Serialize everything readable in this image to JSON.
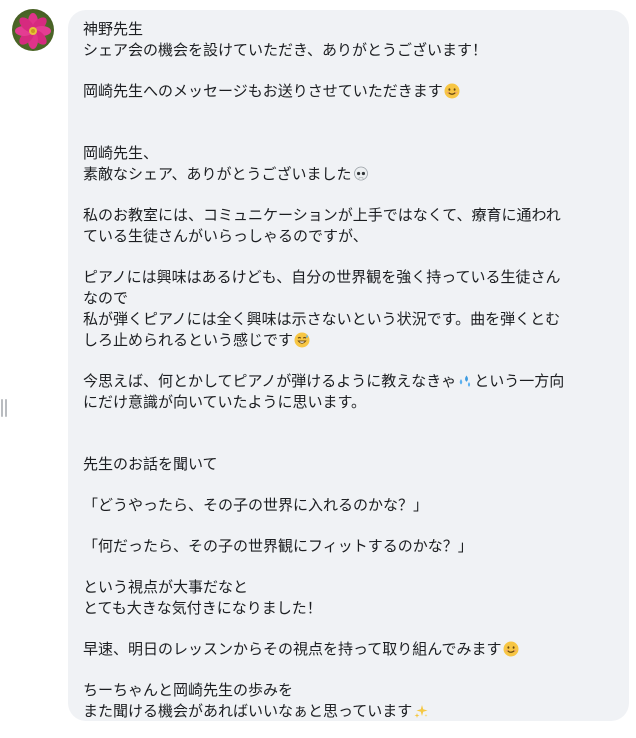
{
  "message": {
    "sender": "神野先生",
    "lines": {
      "l1": "シェア会の機会を設けていただき、ありがとうございます！",
      "l2": "岡崎先生へのメッセージもお送りさせていただきます",
      "l3": "岡崎先生、",
      "l4": "素敵なシェア、ありがとうございました",
      "l5": "私のお教室には、コミュニケーションが上手ではなくて、療育に通われ",
      "l6": "ている生徒さんがいらっしゃるのですが、",
      "l7": "ピアノには興味はあるけども、自分の世界観を強く持っている生徒さん",
      "l8": "なので",
      "l9": "私が弾くピアノには全く興味は示さないという状況です。曲を弾くとむ",
      "l10": "しろ止められるという感じです",
      "l11": "今思えば、何とかしてピアノが弾けるように教えなきゃ",
      "l11b": "という一方向",
      "l12": "にだけ意識が向いていたように思います。",
      "l13": "先生のお話を聞いて",
      "l14": "「どうやったら、その子の世界に入れるのかな？」",
      "l15": "「何だったら、その子の世界観にフィットするのかな？」",
      "l16": "という視点が大事だなと",
      "l17": "とても大きな気付きになりました！",
      "l18": "早速、明日のレッスンからその視点を持って取り組んでみます",
      "l19": "ちーちゃんと岡崎先生の歩みを",
      "l20": "また聞ける機会があればいいなぁと思っています"
    }
  },
  "icons": {
    "avatar": "cosmos-flower-avatar",
    "smile": "smiling-face-emoji",
    "skull": "skull-emoji",
    "sweat": "grinning-sweat-emoji",
    "droplets": "sweat-droplets-emoji",
    "sparkles": "sparkles-emoji"
  },
  "colors": {
    "bubble": "#f0f2f5",
    "text": "#1c1e21",
    "flower": "#e0338a"
  }
}
